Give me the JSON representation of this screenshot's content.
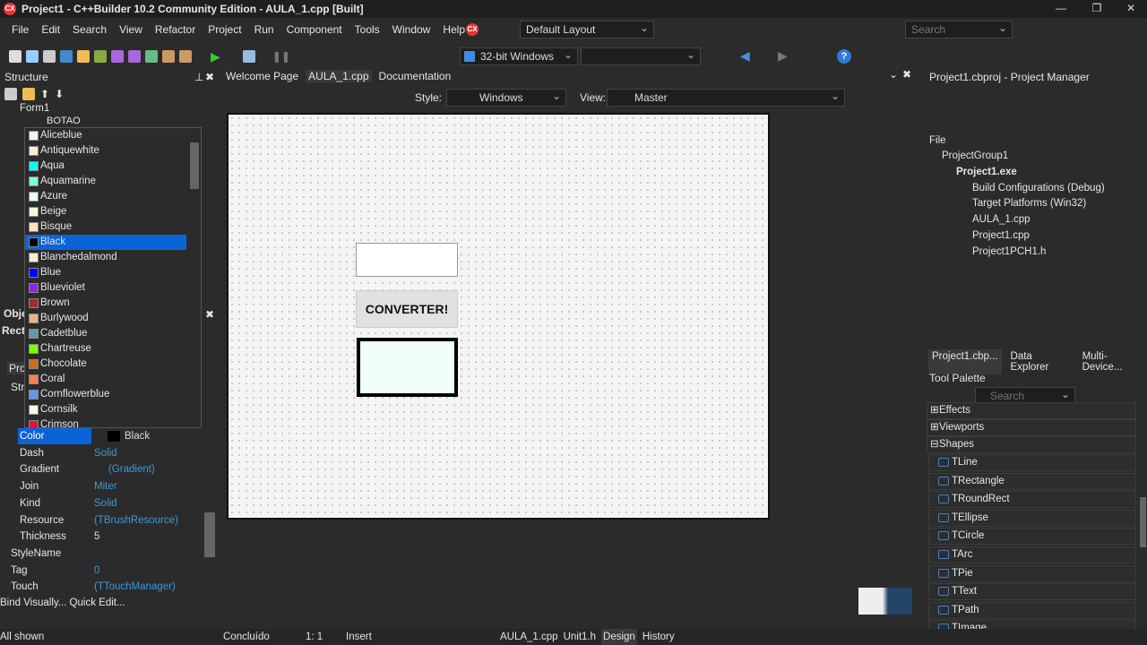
{
  "window": {
    "title": "Project1 - C++Builder 10.2 Community Edition - AULA_1.cpp [Built]",
    "logo": "CX"
  },
  "menu": [
    "File",
    "Edit",
    "Search",
    "View",
    "Refactor",
    "Project",
    "Run",
    "Component",
    "Tools",
    "Window",
    "Help"
  ],
  "toolbar": {
    "layout": "Default Layout",
    "platform": "32-bit Windows",
    "search_placeholder": "Search"
  },
  "structure": {
    "title": "Structure",
    "tree": [
      "Form1",
      "BOTAO"
    ]
  },
  "editor_tabs": [
    "Welcome Page",
    "AULA_1.cpp",
    "Documentation"
  ],
  "designer_bar": {
    "style_label": "Style:",
    "style_value": "Windows",
    "view_label": "View:",
    "view_value": "Master"
  },
  "form": {
    "button_label": "CONVERTER!"
  },
  "color_list": {
    "selected": "Black",
    "items": [
      {
        "name": "Aliceblue",
        "hex": "#F0F8FF"
      },
      {
        "name": "Antiquewhite",
        "hex": "#FAEBD7"
      },
      {
        "name": "Aqua",
        "hex": "#00FFFF"
      },
      {
        "name": "Aquamarine",
        "hex": "#7FFFD4"
      },
      {
        "name": "Azure",
        "hex": "#F0FFFF"
      },
      {
        "name": "Beige",
        "hex": "#F5F5DC"
      },
      {
        "name": "Bisque",
        "hex": "#FFE4C4"
      },
      {
        "name": "Black",
        "hex": "#000000"
      },
      {
        "name": "Blanchedalmond",
        "hex": "#FFEBCD"
      },
      {
        "name": "Blue",
        "hex": "#0000FF"
      },
      {
        "name": "Blueviolet",
        "hex": "#8A2BE2"
      },
      {
        "name": "Brown",
        "hex": "#A52A2A"
      },
      {
        "name": "Burlywood",
        "hex": "#DEB887"
      },
      {
        "name": "Cadetblue",
        "hex": "#5F9EA0"
      },
      {
        "name": "Chartreuse",
        "hex": "#7FFF00"
      },
      {
        "name": "Chocolate",
        "hex": "#D2691E"
      },
      {
        "name": "Coral",
        "hex": "#FF7F50"
      },
      {
        "name": "Cornflowerblue",
        "hex": "#6495ED"
      },
      {
        "name": "Cornsilk",
        "hex": "#FFF8DC"
      },
      {
        "name": "Crimson",
        "hex": "#DC143C"
      }
    ]
  },
  "inspector": {
    "partial": [
      "Obje",
      "Rect",
      "Pro",
      "Str"
    ],
    "properties": [
      {
        "name": "Color",
        "value": "Black"
      },
      {
        "name": "Dash",
        "value": "Solid"
      },
      {
        "name": "Gradient",
        "value": "(Gradient)"
      },
      {
        "name": "Join",
        "value": "Miter"
      },
      {
        "name": "Kind",
        "value": "Solid"
      },
      {
        "name": "Resource",
        "value": "(TBrushResource)"
      },
      {
        "name": "Thickness",
        "value": "5"
      },
      {
        "name": "StyleName",
        "value": ""
      },
      {
        "name": "Tag",
        "value": "0"
      },
      {
        "name": "Touch",
        "value": "(TTouchManager)"
      }
    ],
    "links": "Bind Visually... Quick Edit...",
    "status": "All shown"
  },
  "project_manager": {
    "title": "Project1.cbproj - Project Manager",
    "section": "File",
    "items": [
      "ProjectGroup1",
      "Project1.exe",
      "Build Configurations (Debug)",
      "Target Platforms (Win32)",
      "AULA_1.cpp",
      "Project1.cpp",
      "Project1PCH1.h"
    ]
  },
  "bottom_tabs": [
    "Project1.cbp...",
    "Data Explorer",
    "Multi-Device..."
  ],
  "tool_palette": {
    "title": "Tool Palette",
    "search_placeholder": "Search",
    "categories": [
      "Effects",
      "Viewports",
      "Shapes"
    ],
    "items": [
      "TLine",
      "TRectangle",
      "TRoundRect",
      "TEllipse",
      "TCircle",
      "TArc",
      "TPie",
      "TText",
      "TPath",
      "TImage"
    ]
  },
  "statusbar": {
    "message": "Concluído",
    "position": "1:  1",
    "mode": "Insert",
    "tabs": [
      "AULA_1.cpp",
      "Unit1.h",
      "Design",
      "History"
    ],
    "active_tab": "Design"
  }
}
